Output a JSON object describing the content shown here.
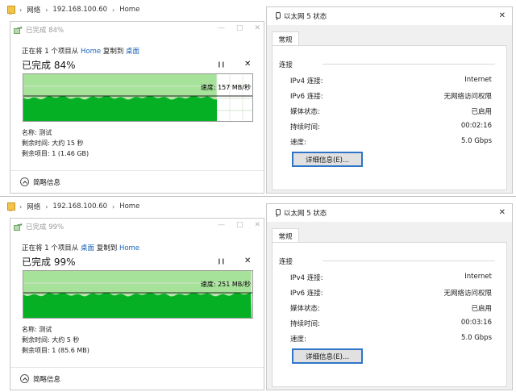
{
  "panels": [
    {
      "breadcrumb": [
        "网络",
        "192.168.100.60",
        "Home"
      ],
      "copy": {
        "title": "已完成 84%",
        "line_prefix": "正在将 1 个项目从 ",
        "from": "Home",
        "line_mid": " 复制到 ",
        "to": "桌面",
        "percent_label": "已完成 84%",
        "progress": 0.84,
        "speed": "速度: 157 MB/秒",
        "name": "名称: 测试",
        "time_left": "剩余时间: 大约 15 秒",
        "items_left": "剩余项目: 1 (1.46 GB)",
        "less_details": "简略信息"
      },
      "status": {
        "title": "以太网 5 状态",
        "tab": "常规",
        "section": "连接",
        "rows": [
          {
            "label": "IPv4 连接:",
            "value": "Internet"
          },
          {
            "label": "IPv6 连接:",
            "value": "无网络访问权限"
          },
          {
            "label": "媒体状态:",
            "value": "已启用"
          },
          {
            "label": "持续时间:",
            "value": "00:02:16"
          },
          {
            "label": "速度:",
            "value": "5.0 Gbps"
          }
        ],
        "details_button": "详细信息(E)..."
      }
    },
    {
      "breadcrumb": [
        "网络",
        "192.168.100.60",
        "Home"
      ],
      "copy": {
        "title": "已完成 99%",
        "line_prefix": "正在将 1 个项目从 ",
        "from": "桌面",
        "line_mid": " 复制到 ",
        "to": "Home",
        "percent_label": "已完成 99%",
        "progress": 0.99,
        "speed": "速度: 251 MB/秒",
        "name": "名称: 测试",
        "time_left": "剩余时间: 大约 5 秒",
        "items_left": "剩余项目: 1 (85.6 MB)",
        "less_details": "简略信息"
      },
      "status": {
        "title": "以太网 5 状态",
        "tab": "常规",
        "section": "连接",
        "rows": [
          {
            "label": "IPv4 连接:",
            "value": "Internet"
          },
          {
            "label": "IPv6 连接:",
            "value": "无网络访问权限"
          },
          {
            "label": "媒体状态:",
            "value": "已启用"
          },
          {
            "label": "持续时间:",
            "value": "00:03:16"
          },
          {
            "label": "速度:",
            "value": "5.0 Gbps"
          }
        ],
        "details_button": "详细信息(E)..."
      }
    }
  ],
  "colors": {
    "progress_fill": "#a6e29a",
    "graph_fill": "#06b025",
    "link": "#1a63b8",
    "button_focus": "#2e75c8"
  }
}
